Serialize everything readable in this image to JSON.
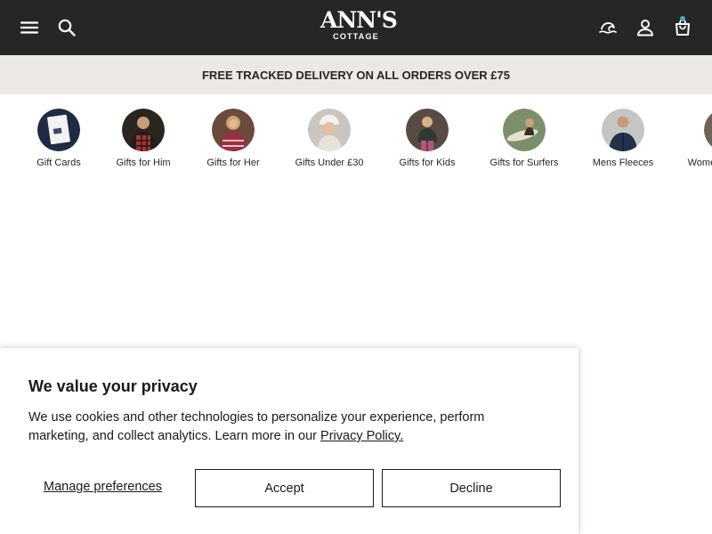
{
  "header": {
    "logo_main": "ANN'S",
    "logo_sub": "COTTAGE",
    "icons": [
      "menu-icon",
      "search-icon",
      "surf-wave-icon",
      "account-icon",
      "cart-icon"
    ]
  },
  "promo": {
    "text": "FREE TRACKED DELIVERY ON ALL ORDERS OVER £75"
  },
  "categories": [
    {
      "label": "Gift Cards"
    },
    {
      "label": "Gifts for Him"
    },
    {
      "label": "Gifts for Her"
    },
    {
      "label": "Gifts Under £30"
    },
    {
      "label": "Gifts for Kids"
    },
    {
      "label": "Gifts for Surfers"
    },
    {
      "label": "Mens Fleeces"
    },
    {
      "label": "Womens Fleeces"
    }
  ],
  "consent": {
    "title": "We value your privacy",
    "body": "We use cookies and other technologies to personalize your experience, perform marketing, and collect analytics. Learn more in our ",
    "policy_link": "Privacy Policy.",
    "manage_label": "Manage preferences",
    "accept_label": "Accept",
    "decline_label": "Decline"
  },
  "colors": {
    "header_bg": "#262626",
    "promo_bg": "#ece9e4",
    "text": "#1a1a1a",
    "cart_dot": "#5aa0c8"
  }
}
